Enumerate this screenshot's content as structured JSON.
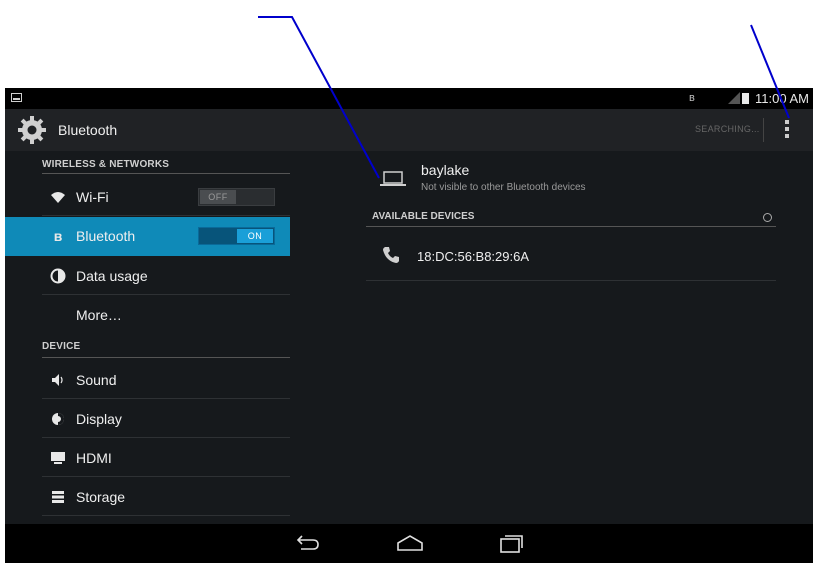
{
  "status_bar": {
    "time": "11:00 AM"
  },
  "action_bar": {
    "title": "Bluetooth",
    "searching_label": "SEARCHING..."
  },
  "sidebar": {
    "wireless_header": "WIRELESS & NETWORKS",
    "device_header": "DEVICE",
    "items": [
      {
        "label": "Wi-Fi",
        "icon": "wifi-icon",
        "toggle": "OFF"
      },
      {
        "label": "Bluetooth",
        "icon": "bluetooth-icon",
        "toggle": "ON",
        "selected": true
      },
      {
        "label": "Data usage",
        "icon": "data-usage-icon"
      },
      {
        "label": "More…"
      },
      {
        "label": "Sound",
        "icon": "sound-icon"
      },
      {
        "label": "Display",
        "icon": "display-icon"
      },
      {
        "label": "HDMI",
        "icon": "hdmi-icon"
      },
      {
        "label": "Storage",
        "icon": "storage-icon"
      }
    ]
  },
  "main": {
    "local_device": {
      "name": "baylake",
      "status": "Not visible to other Bluetooth devices"
    },
    "available_header": "AVAILABLE DEVICES",
    "devices": [
      {
        "address": "18:DC:56:B8:29:6A",
        "icon": "phone-icon"
      }
    ]
  },
  "colors": {
    "accent": "#0f8ab8",
    "annotation": "#0000cc",
    "background": "#16191c"
  }
}
